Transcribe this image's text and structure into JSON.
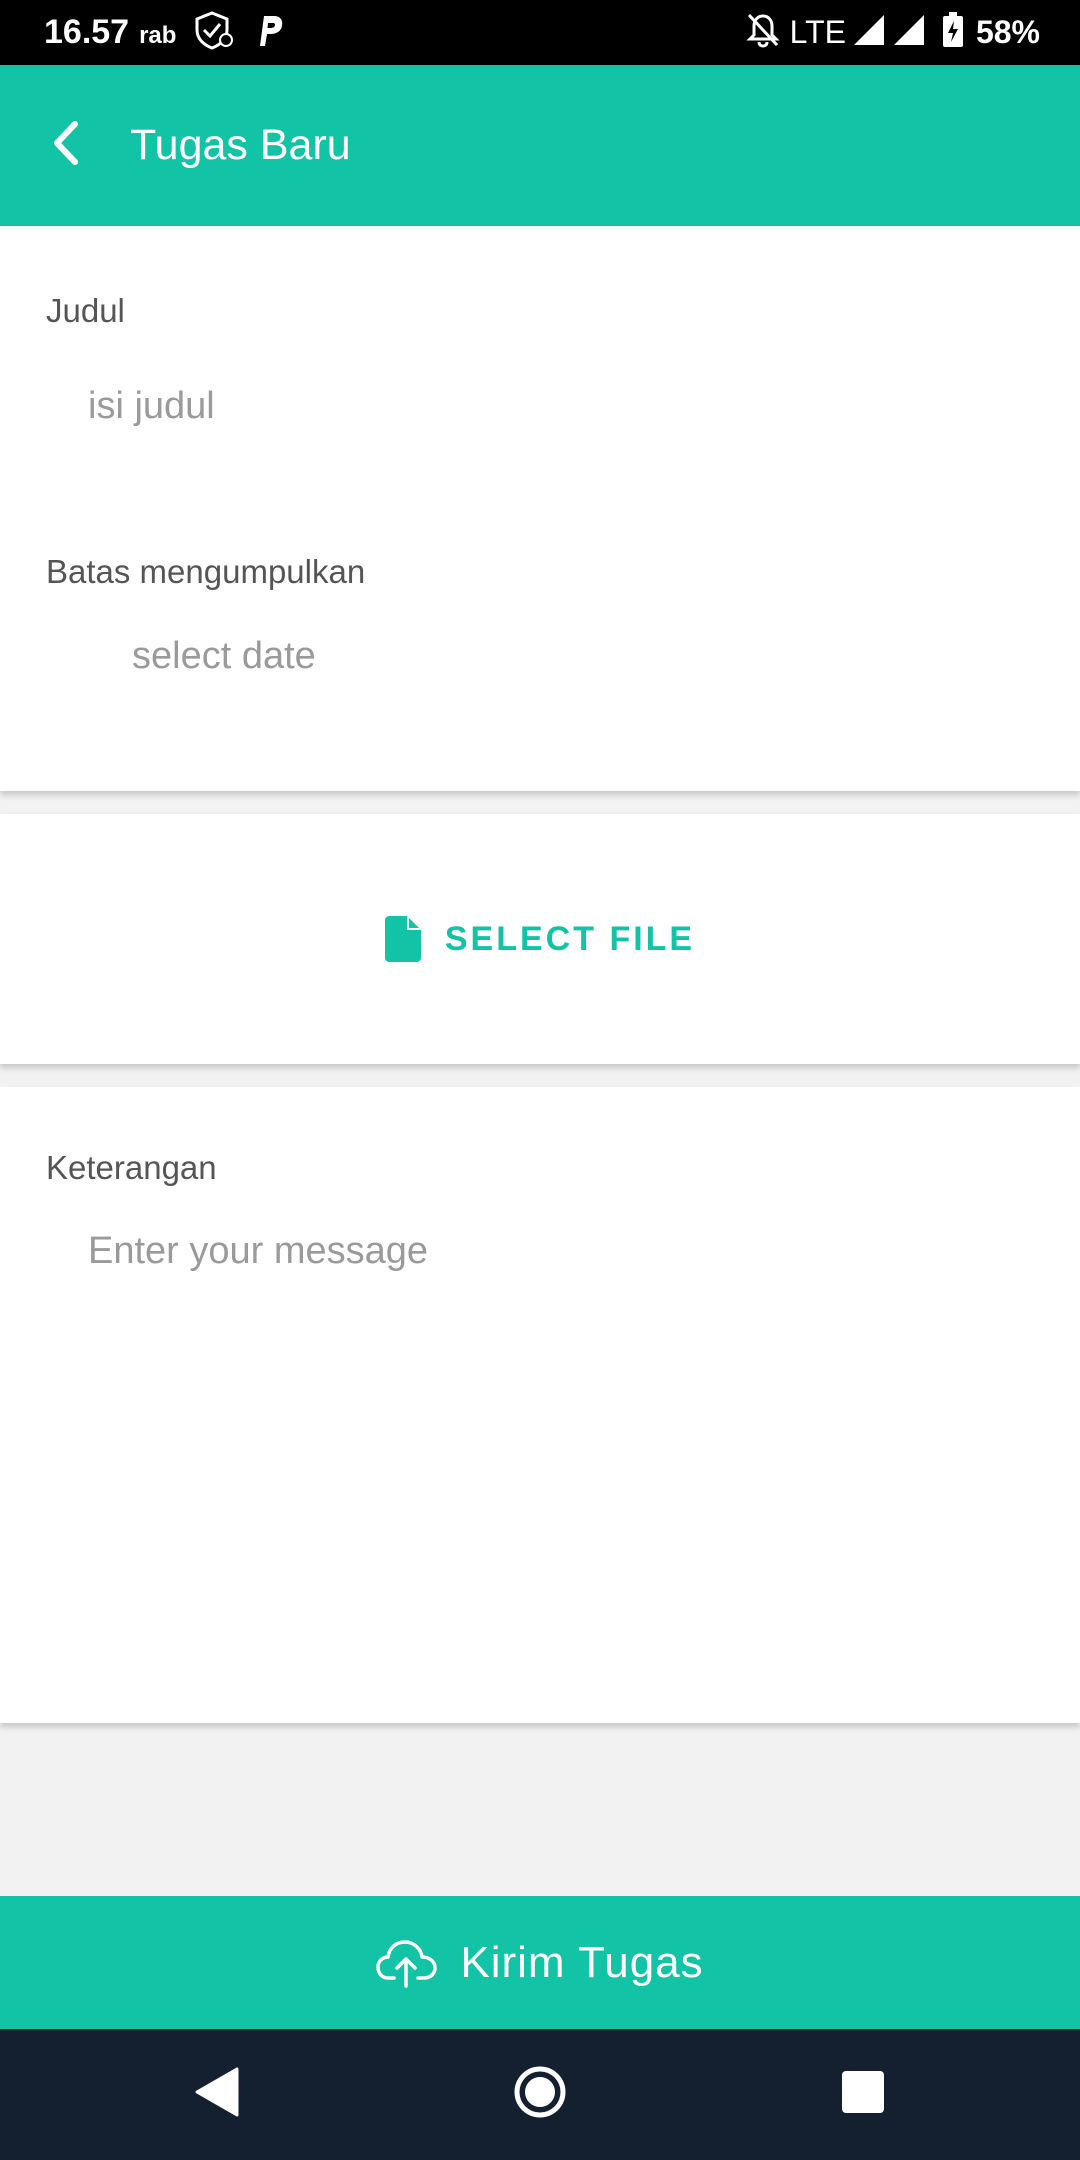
{
  "status_bar": {
    "time": "16.57",
    "day": "rab",
    "network": "LTE",
    "battery": "58%",
    "icons": [
      "shield-check-icon",
      "parking-icon",
      "notifications-off-icon",
      "signal-icon",
      "signal-icon",
      "battery-charging-icon"
    ]
  },
  "app_bar": {
    "title": "Tugas Baru",
    "back_icon": "chevron-left-icon"
  },
  "form": {
    "judul_label": "Judul",
    "judul_placeholder": "isi judul",
    "judul_value": "",
    "deadline_label": "Batas mengumpulkan",
    "deadline_placeholder": "select date",
    "deadline_value": ""
  },
  "file": {
    "select_label": "SELECT FILE",
    "icon": "file-icon"
  },
  "note": {
    "label": "Keterangan",
    "placeholder": "Enter your message",
    "value": ""
  },
  "send": {
    "label": "Kirim Tugas",
    "icon": "cloud-upload-icon"
  },
  "nav": {
    "icons": [
      "back-triangle-icon",
      "home-circle-icon",
      "recents-square-icon"
    ]
  },
  "colors": {
    "accent": "#12c3a6",
    "status_bar": "#000000",
    "nav_bar": "#141f30",
    "background": "#f2f2f2"
  }
}
